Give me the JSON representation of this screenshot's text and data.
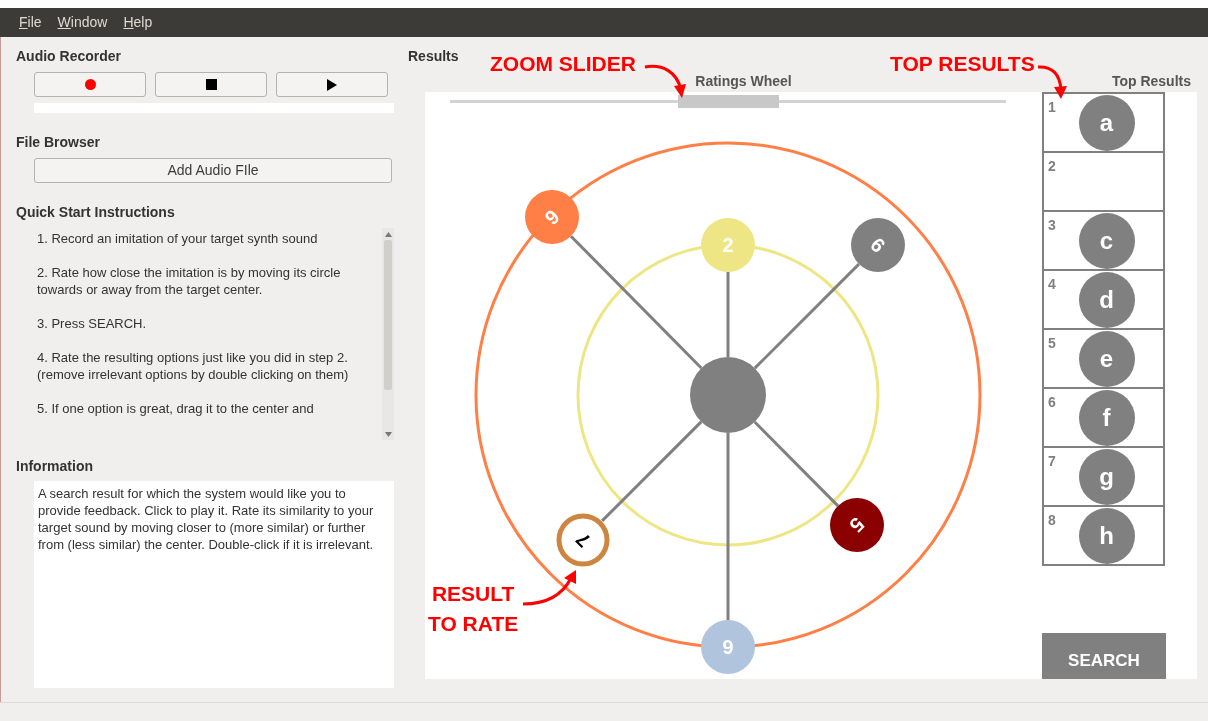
{
  "menu": [
    "File",
    "Window",
    "Help"
  ],
  "audio_recorder": {
    "title": "Audio Recorder",
    "buttons": [
      {
        "kind": "record"
      },
      {
        "kind": "stop"
      },
      {
        "kind": "play"
      }
    ]
  },
  "file_browser": {
    "title": "File Browser",
    "button": "Add Audio FIle"
  },
  "instructions": {
    "title": "Quick Start Instructions",
    "items": [
      "1. Record an imitation of your target  synth sound",
      "2. Rate how close the imitation is by moving its circle towards or away from the target center.",
      "3. Press SEARCH.",
      "4. Rate the resulting options just like you did in step 2. (remove irrelevant options by double clicking on them)",
      "5. If one option is great, drag it to the center and"
    ]
  },
  "information": {
    "title": "Information",
    "text": "A search result for which the system would like you to provide feedback. Click to play it. Rate its similarity to your target sound by moving closer to (more similar) or further from (less similar) the center. Double-click if it is irrelevant."
  },
  "results": {
    "title": "Results",
    "wheel": {
      "title": "Ratings Wheel",
      "zoom_slider": {
        "level": 0.5
      },
      "nodes": [
        {
          "label": "9",
          "color": "#ff7f46",
          "kind": "filled"
        },
        {
          "label": "2",
          "color": "#eee685",
          "kind": "filled"
        },
        {
          "label": "6",
          "color": "#808080",
          "kind": "filled"
        },
        {
          "label": "5",
          "color": "#8b0000",
          "kind": "filled"
        },
        {
          "label": "6",
          "color": "#b0c4de",
          "kind": "filled"
        },
        {
          "label": "7",
          "color": "#cd853f",
          "kind": "outline"
        }
      ]
    },
    "top_results": {
      "title": "Top Results",
      "items": [
        {
          "rank": "1",
          "label": "a"
        },
        {
          "rank": "2"
        },
        {
          "rank": "3",
          "label": "c"
        },
        {
          "rank": "4",
          "label": "d"
        },
        {
          "rank": "5",
          "label": "e"
        },
        {
          "rank": "6",
          "label": "f"
        },
        {
          "rank": "7",
          "label": "g"
        },
        {
          "rank": "8",
          "label": "h"
        }
      ]
    },
    "search_button": "SEARCH"
  },
  "annotations": [
    {
      "kind": "slider",
      "lines": [
        "ZOOM SLIDER"
      ]
    },
    {
      "kind": "top",
      "lines": [
        "TOP RESULTS"
      ]
    },
    {
      "kind": "rate",
      "lines": [
        "RESULT",
        "TO RATE"
      ]
    }
  ]
}
